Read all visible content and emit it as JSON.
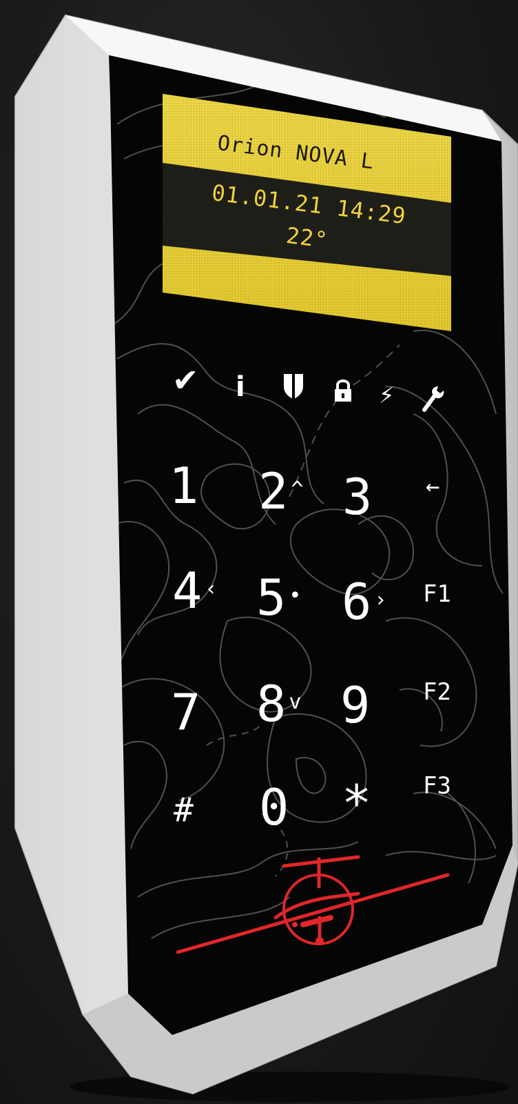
{
  "display": {
    "title": "Orion NOVA L",
    "datetime": "01.01.21 14:29",
    "temperature": "22°"
  },
  "status_icons": [
    "check-icon",
    "info-icon",
    "shield-icon",
    "lock-icon",
    "lightning-icon",
    "wrench-icon"
  ],
  "keypad": {
    "k1": {
      "main": "1",
      "sub": ""
    },
    "k2": {
      "main": "2",
      "sub": "^"
    },
    "k3": {
      "main": "3",
      "sub": ""
    },
    "back": {
      "main": "←",
      "sub": ""
    },
    "k4": {
      "main": "4",
      "sub": "‹"
    },
    "k5": {
      "main": "5",
      "sub": "•"
    },
    "k6": {
      "main": "6",
      "sub": "›"
    },
    "f1": {
      "main": "F1",
      "sub": ""
    },
    "k7": {
      "main": "7",
      "sub": ""
    },
    "k8": {
      "main": "8",
      "sub": "v"
    },
    "k9": {
      "main": "9",
      "sub": ""
    },
    "f2": {
      "main": "F2",
      "sub": ""
    },
    "hash": {
      "main": "#",
      "sub": ""
    },
    "k0": {
      "main": "0",
      "sub": ""
    },
    "star": {
      "main": "*",
      "sub": ""
    },
    "f3": {
      "main": "F3",
      "sub": ""
    }
  },
  "colors": {
    "housing": "#e6e6e6",
    "faceplate": "#050505",
    "lcd_backlight": "#ecd33a",
    "lcd_dark_band": "#1f1f1a",
    "text_lcd": "#f0d23c",
    "keys": "#ffffff",
    "logo": "#e0262a"
  }
}
